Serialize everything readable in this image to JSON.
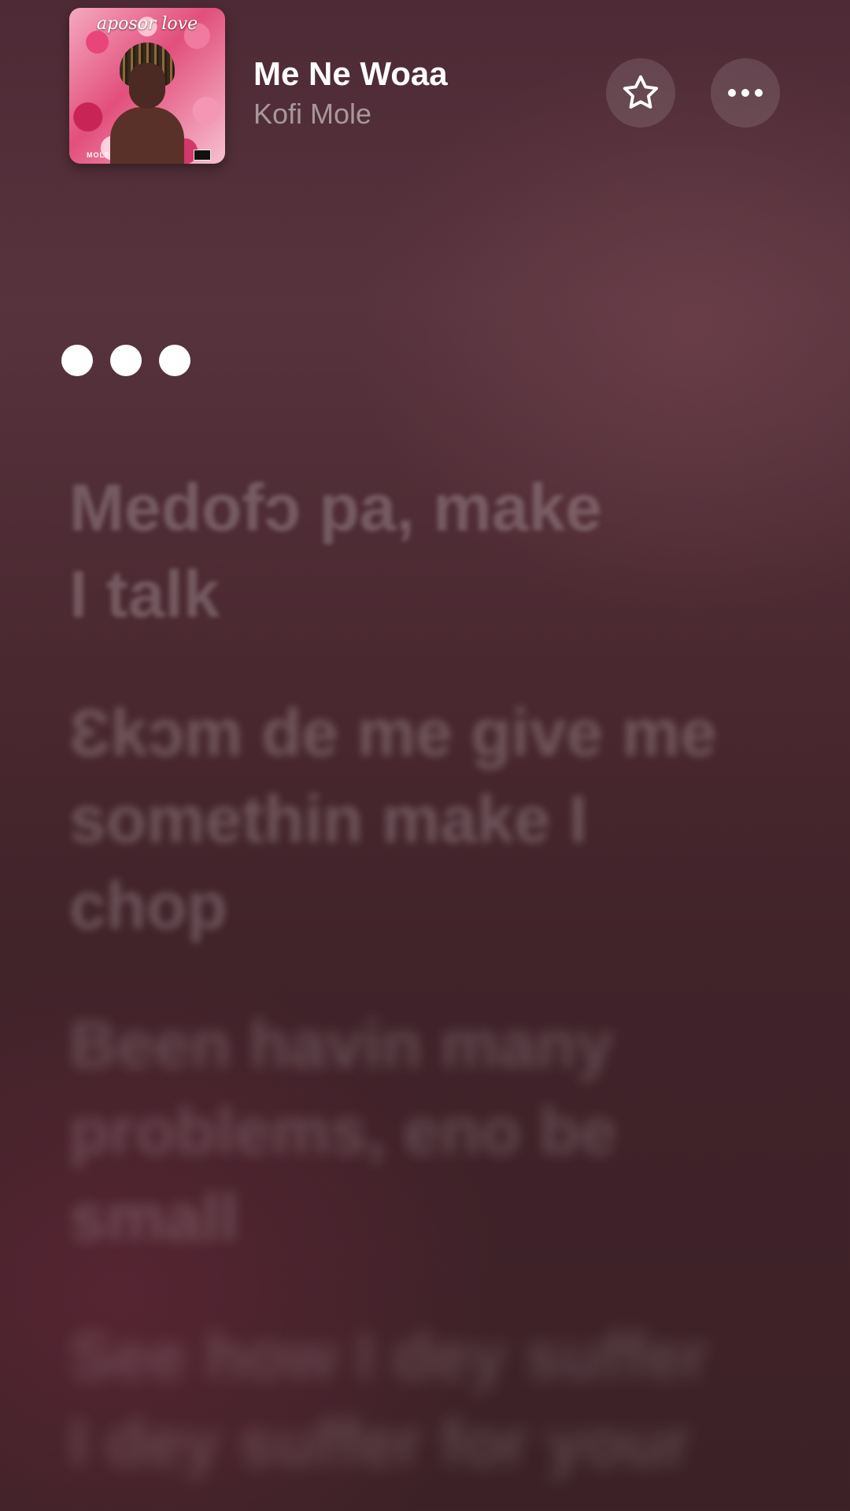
{
  "now_playing": {
    "title": "Me Ne Woaa",
    "artist": "Kofi Mole",
    "album_art": {
      "cover_text": "aposor love",
      "cover_artist": "MOLE"
    }
  },
  "actions": {
    "favorite_icon": "star-outline-icon",
    "more_icon": "ellipsis-icon"
  },
  "lyrics": {
    "interlude_indicator": "three-dots",
    "lines": [
      "Medofɔ pa, make\nI talk",
      "Ɛkɔm de me give me\nsomethin make I\nchop",
      "Been havin many\nproblems, eno be\nsmall",
      "See how I dey suffer\nI dey suffer for your"
    ]
  },
  "colors": {
    "background_top": "#4d2a35",
    "background_bottom": "#3c2227",
    "primary_text": "#ffffff",
    "secondary_text": "rgba(255,255,255,0.5)"
  }
}
